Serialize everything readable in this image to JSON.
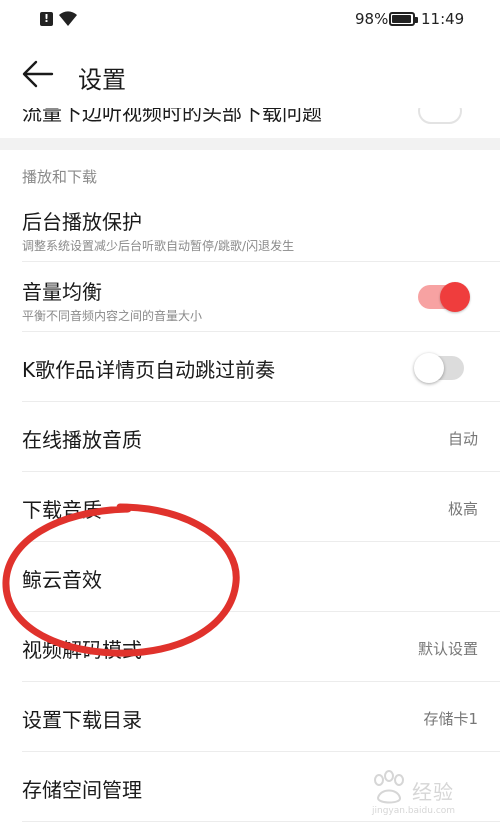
{
  "status_bar": {
    "alert_glyph": "!",
    "battery_pct": "98%",
    "time": "11:49"
  },
  "header": {
    "title": "设置"
  },
  "partial_row": {
    "title": "流量下边听视频时的头部下载问题"
  },
  "section": {
    "title": "播放和下载"
  },
  "rows": [
    {
      "title": "后台播放保护",
      "subtitle": "调整系统设置减少后台听歌自动暂停/跳歌/闪退发生"
    },
    {
      "title": "音量均衡",
      "subtitle": "平衡不同音频内容之间的音量大小",
      "toggle": "on"
    },
    {
      "title": "K歌作品详情页自动跳过前奏",
      "toggle": "off"
    },
    {
      "title": "在线播放音质",
      "value": "自动"
    },
    {
      "title": "下载音质",
      "value": "极高"
    },
    {
      "title": "鲸云音效"
    },
    {
      "title": "视频解码模式",
      "value": "默认设置"
    },
    {
      "title": "设置下载目录",
      "value": "存储卡1"
    },
    {
      "title": "存储空间管理"
    }
  ],
  "watermark": {
    "text": "经验",
    "url": "jingyan.baidu.com"
  },
  "colors": {
    "accent": "#ef3d3d",
    "annotation": "#e0322c",
    "divider": "#ececec"
  }
}
